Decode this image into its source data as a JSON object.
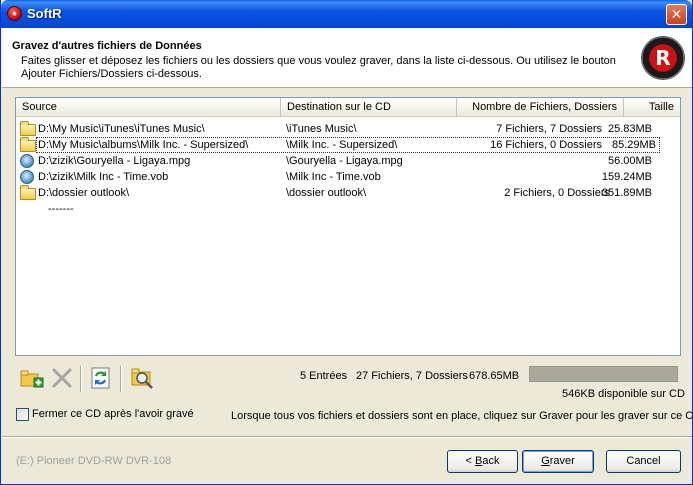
{
  "window": {
    "title": "SoftR",
    "close_glyph": "✕"
  },
  "header": {
    "title": "Gravez d'autres fichiers de Données",
    "description": "Faites glisser et déposez les fichiers ou les dossiers que vous voulez graver, dans la liste ci-dessous. Ou utilisez le bouton Ajouter Fichiers/Dossiers ci-dessous.",
    "logo_letter": "R"
  },
  "list": {
    "columns": [
      "Source",
      "Destination sur le CD",
      "Nombre de Fichiers, Dossiers",
      "Taille"
    ],
    "rows": [
      {
        "icon": "folder-icon",
        "source": "D:\\My Music\\iTunes\\iTunes Music\\",
        "destination": "\\iTunes Music\\",
        "count": "7 Fichiers, 7 Dossiers",
        "size": "25.83MB"
      },
      {
        "icon": "folder-icon",
        "source": "D:\\My Music\\albums\\Milk Inc. - Supersized\\",
        "destination": "\\Milk Inc. - Supersized\\",
        "count": "16 Fichiers, 0 Dossiers",
        "size": "85.29MB"
      },
      {
        "icon": "media-file-icon",
        "source": "D:\\zizik\\Gouryella - Ligaya.mpg",
        "destination": "\\Gouryella - Ligaya.mpg",
        "count": "",
        "size": "56.00MB"
      },
      {
        "icon": "media-file-icon",
        "source": "D:\\zizik\\Milk Inc - Time.vob",
        "destination": "\\Milk Inc - Time.vob",
        "count": "",
        "size": "159.24MB"
      },
      {
        "icon": "folder-icon",
        "source": "D:\\dossier outlook\\",
        "destination": "\\dossier outlook\\",
        "count": "2 Fichiers, 0 Dossiers",
        "size": "351.89MB"
      }
    ],
    "trailing_text": "-------"
  },
  "toolbar": {
    "icons": [
      "add-files-folders-icon",
      "remove-icon",
      "refresh-icon",
      "search-folder-icon"
    ]
  },
  "stats": {
    "entries": "5 Entrées",
    "totals": "27 Fichiers, 7 Dossiers",
    "size": "678.65MB",
    "available": "546KB disponible sur CD",
    "progress_fraction": 1.0,
    "progress_color": "#aca899"
  },
  "options": {
    "close_cd_label": "Fermer ce CD après l'avoir gravé",
    "close_cd_checked": false
  },
  "hint": "Lorsque tous vos fichiers et dossiers sont en place, cliquez sur Graver pour les graver sur ce CD",
  "drive": "(E:) Pioneer DVD-RW DVR-108",
  "buttons": {
    "back_prefix": "< ",
    "back_accel": "B",
    "back_rest": "ack",
    "burn_accel": "G",
    "burn_rest": "raver",
    "cancel": "Cancel"
  }
}
